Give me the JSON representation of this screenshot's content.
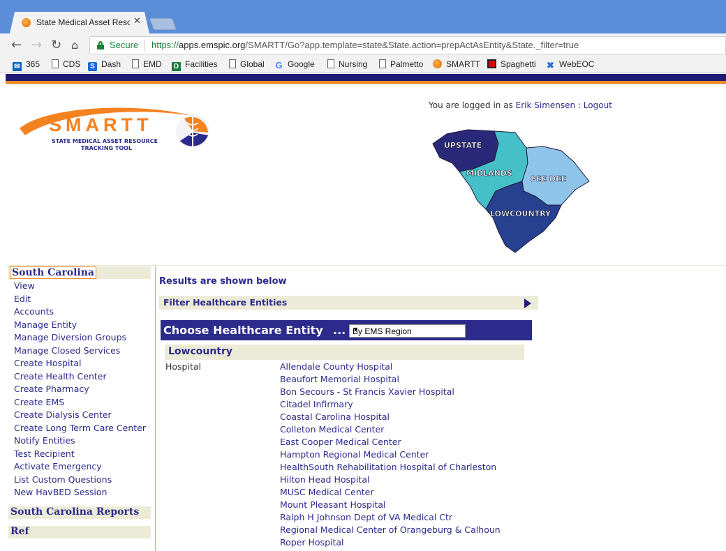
{
  "browser": {
    "tab_title": "State Medical Asset Resource",
    "tab_close": "✕",
    "secure_label": "Secure",
    "url": {
      "scheme": "https://",
      "host": "apps.emspic.org",
      "path": "/SMARTT/Go?app.template=state&State.action=prepActAsEntity&State._filter=true"
    },
    "bookmarks": [
      {
        "label": "365",
        "icon": "mail-icon"
      },
      {
        "label": "CDS",
        "icon": "page-icon"
      },
      {
        "label": "Dash",
        "icon": "dash-icon"
      },
      {
        "label": "EMD",
        "icon": "page-icon"
      },
      {
        "label": "Facilities",
        "icon": "d-icon"
      },
      {
        "label": "Global",
        "icon": "page-icon"
      },
      {
        "label": "Google",
        "icon": "google-icon"
      },
      {
        "label": "Nursing",
        "icon": "page-icon"
      },
      {
        "label": "Palmetto",
        "icon": "page-icon"
      },
      {
        "label": "SMARTT",
        "icon": "smartt-icon"
      },
      {
        "label": "Spaghetti",
        "icon": "spaghetti-icon"
      },
      {
        "label": "WebEOC",
        "icon": "webeoc-icon"
      }
    ]
  },
  "header": {
    "logo_word": "SMARTT",
    "logo_sub1": "STATE MEDICAL ASSET RESOURCE",
    "logo_sub2": "TRACKING TOOL",
    "login_prefix": "You are logged in as",
    "user_name": "Erik Simensen",
    "separator": " : ",
    "logout_label": "Logout"
  },
  "map": {
    "regions": {
      "upstate": "UPSTATE",
      "midlands": "MIDLANDS",
      "peedee": "PEE DEE",
      "lowcountry": "LOWCOUNTRY"
    },
    "colors": {
      "upstate": "#2a2878",
      "midlands": "#45c0c8",
      "peedee": "#8fc4ea",
      "lowcountry": "#27408f"
    }
  },
  "sidebar": {
    "section_title": "South Carolina",
    "items": [
      "View",
      "Edit",
      "Accounts",
      "Manage Entity",
      "Manage Diversion Groups",
      "Manage Closed Services",
      "Create Hospital",
      "Create Health Center",
      "Create Pharmacy",
      "Create EMS",
      "Create Dialysis Center",
      "Create Long Term Care Center",
      "Notify Entities",
      "Test Recipient",
      "Activate Emergency",
      "List Custom Questions",
      "New HavBED Session"
    ],
    "reports_title": "South Carolina Reports",
    "ref_title": "Ref"
  },
  "main": {
    "results_title": "Results are shown below",
    "filter_label": "Filter Healthcare Entities",
    "choose_label": "Choose Healthcare Entity",
    "choose_dots": "...",
    "region_select_value": "By EMS Region",
    "region_title": "Lowcountry",
    "entity_type": "Hospital",
    "hospitals": [
      "Allendale County Hospital",
      "Beaufort Memorial Hospital",
      "Bon Secours - St Francis Xavier Hospital",
      "Citadel Infirmary",
      "Coastal Carolina Hospital",
      "Colleton Medical Center",
      "East Cooper Medical Center",
      "Hampton Regional Medical Center",
      "HealthSouth Rehabilitation Hospital of Charleston",
      "Hilton Head Hospital",
      "MUSC Medical Center",
      "Mount Pleasant Hospital",
      "Ralph H Johnson Dept of VA Medical Ctr",
      "Regional Medical Center of Orangeburg & Calhoun",
      "Roper Hospital"
    ]
  }
}
